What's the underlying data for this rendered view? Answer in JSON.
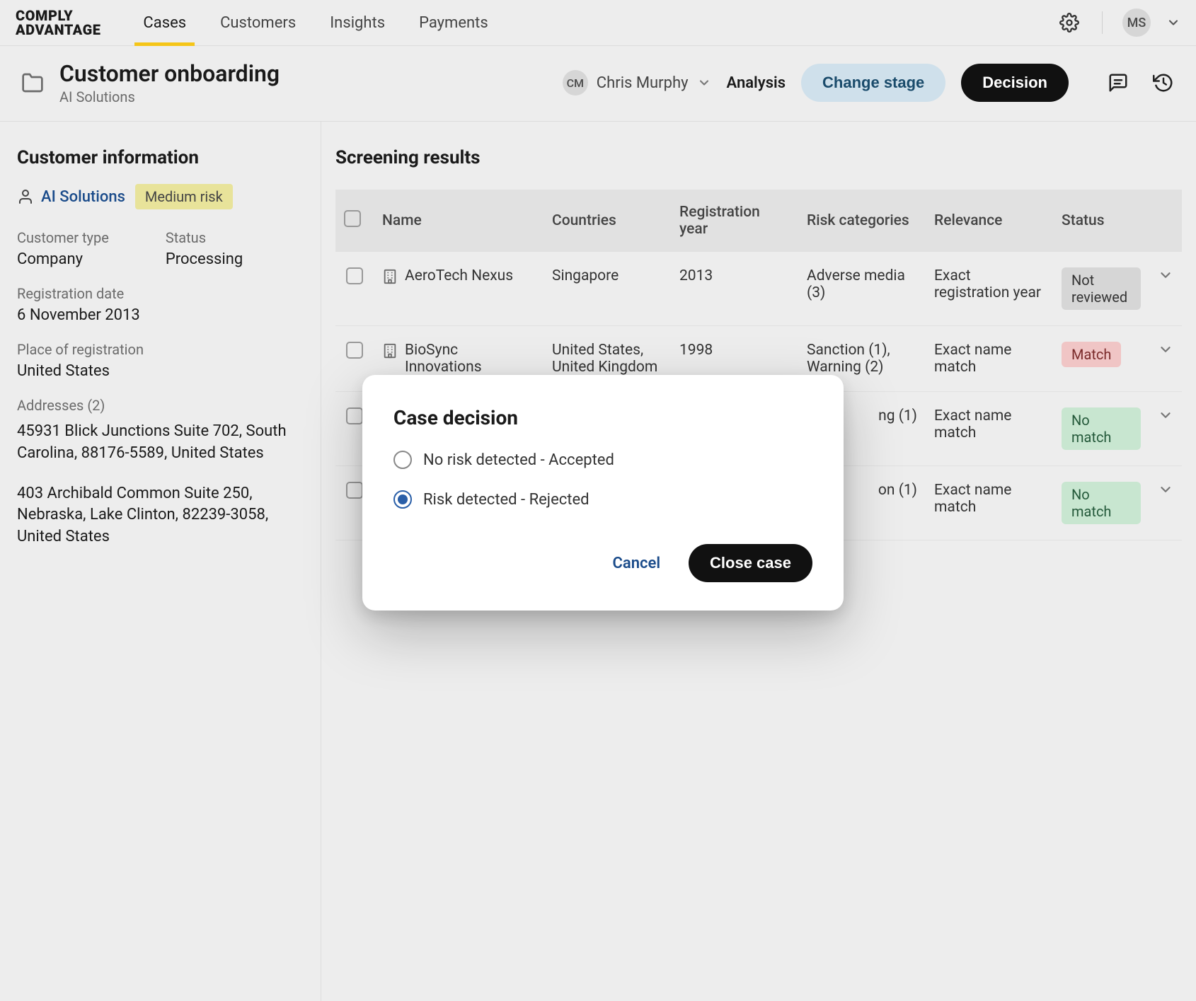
{
  "brand": {
    "line1": "COMPLY",
    "line2": "ADVANTAGE"
  },
  "nav": {
    "tabs": [
      "Cases",
      "Customers",
      "Insights",
      "Payments"
    ],
    "activeIndex": 0
  },
  "topRight": {
    "userInitials": "MS"
  },
  "caseHeader": {
    "title": "Customer onboarding",
    "subtitle": "AI Solutions",
    "assignee": {
      "initials": "CM",
      "name": "Chris Murphy"
    },
    "analysisLabel": "Analysis",
    "changeStageLabel": "Change stage",
    "decisionLabel": "Decision"
  },
  "sidebar": {
    "heading": "Customer information",
    "customerName": "AI Solutions",
    "riskLabel": "Medium risk",
    "customerType": {
      "label": "Customer type",
      "value": "Company"
    },
    "status": {
      "label": "Status",
      "value": "Processing"
    },
    "registrationDate": {
      "label": "Registration date",
      "value": "6 November 2013"
    },
    "placeOfRegistration": {
      "label": "Place of registration",
      "value": "United States"
    },
    "addressesHeading": "Addresses (2)",
    "addresses": [
      "45931 Blick Junctions Suite 702, South Carolina, 88176-5589, United States",
      "403 Archibald Common Suite 250, Nebraska, Lake Clinton, 82239-3058, United States"
    ]
  },
  "content": {
    "heading": "Screening results",
    "columns": [
      "Name",
      "Countries",
      "Registration year",
      "Risk categories",
      "Relevance",
      "Status"
    ],
    "rows": [
      {
        "name": "AeroTech Nexus",
        "countries": "Singapore",
        "registrationYear": "2013",
        "riskCategories": "Adverse media (3)",
        "relevance": "Exact registration year",
        "status": {
          "label": "Not reviewed",
          "kind": "gray"
        }
      },
      {
        "name": "BioSync Innovations",
        "countries": "United States, United Kingdom",
        "registrationYear": "1998",
        "riskCategories": "Sanction (1), Warning (2)",
        "relevance": "Exact name match",
        "status": {
          "label": "Match",
          "kind": "red"
        }
      },
      {
        "name": "",
        "countries": "",
        "registrationYear": "",
        "riskCategories": "ng (1)",
        "relevance": "Exact name match",
        "status": {
          "label": "No match",
          "kind": "green"
        },
        "obscured": true
      },
      {
        "name": "",
        "countries": "",
        "registrationYear": "",
        "riskCategories": "on (1)",
        "relevance": "Exact name match",
        "status": {
          "label": "No match",
          "kind": "green"
        },
        "obscured": true
      }
    ]
  },
  "dialog": {
    "title": "Case decision",
    "options": [
      {
        "label": "No risk detected - Accepted",
        "selected": false
      },
      {
        "label": "Risk detected - Rejected",
        "selected": true
      }
    ],
    "cancelLabel": "Cancel",
    "closeLabel": "Close case"
  }
}
